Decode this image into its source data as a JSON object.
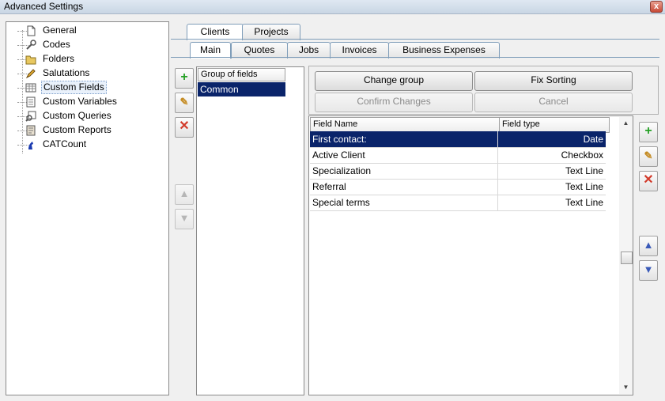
{
  "window": {
    "title": "Advanced Settings",
    "close_label": "x"
  },
  "tree": {
    "items": [
      {
        "label": "General",
        "icon": "page-icon"
      },
      {
        "label": "Codes",
        "icon": "wrench-icon"
      },
      {
        "label": "Folders",
        "icon": "folder-icon"
      },
      {
        "label": "Salutations",
        "icon": "pencil-icon"
      },
      {
        "label": "Custom Fields",
        "icon": "grid-icon",
        "selected": true
      },
      {
        "label": "Custom Variables",
        "icon": "list-icon"
      },
      {
        "label": "Custom Queries",
        "icon": "query-icon"
      },
      {
        "label": "Custom Reports",
        "icon": "report-icon"
      },
      {
        "label": "CATCount",
        "icon": "cat-icon"
      }
    ]
  },
  "tabs_top": [
    {
      "label": "Clients",
      "active": true
    },
    {
      "label": "Projects",
      "active": false
    }
  ],
  "tabs_sub": [
    {
      "label": "Main",
      "active": true
    },
    {
      "label": "Quotes",
      "active": false
    },
    {
      "label": "Jobs",
      "active": false
    },
    {
      "label": "Invoices",
      "active": false
    },
    {
      "label": "Business Expenses",
      "active": false
    }
  ],
  "groups": {
    "header": "Group of fields",
    "items": [
      "Common"
    ]
  },
  "buttons": {
    "change_group": "Change group",
    "fix_sorting": "Fix Sorting",
    "confirm_changes": "Confirm Changes",
    "cancel": "Cancel"
  },
  "fields": {
    "headers": [
      "Field Name",
      "Field type"
    ],
    "rows": [
      {
        "name": "First contact:",
        "type": "Date",
        "selected": true
      },
      {
        "name": "Active Client",
        "type": "Checkbox"
      },
      {
        "name": "Specialization",
        "type": "Text Line"
      },
      {
        "name": "Referral",
        "type": "Text Line"
      },
      {
        "name": "Special terms",
        "type": "Text Line"
      }
    ]
  },
  "colors": {
    "selection": "#0a246a",
    "add": "#23a023",
    "delete": "#d23a2a",
    "arrow": "#3a5ab8"
  }
}
